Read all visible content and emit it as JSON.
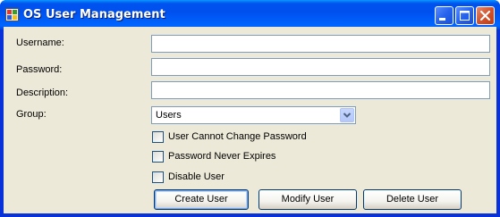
{
  "window": {
    "title": "OS User Management",
    "icons": [
      "app-icon",
      "minimize-icon",
      "maximize-icon",
      "close-icon"
    ]
  },
  "form": {
    "username": {
      "label": "Username:",
      "value": ""
    },
    "password": {
      "label": "Password:",
      "value": ""
    },
    "description": {
      "label": "Description:",
      "value": ""
    },
    "group": {
      "label": "Group:",
      "selected": "Users"
    }
  },
  "options": [
    {
      "label": "User Cannot Change Password",
      "checked": false
    },
    {
      "label": "Password Never Expires",
      "checked": false
    },
    {
      "label": "Disable User",
      "checked": false
    }
  ],
  "buttons": {
    "create": "Create User",
    "modify": "Modify User",
    "delete": "Delete User"
  }
}
